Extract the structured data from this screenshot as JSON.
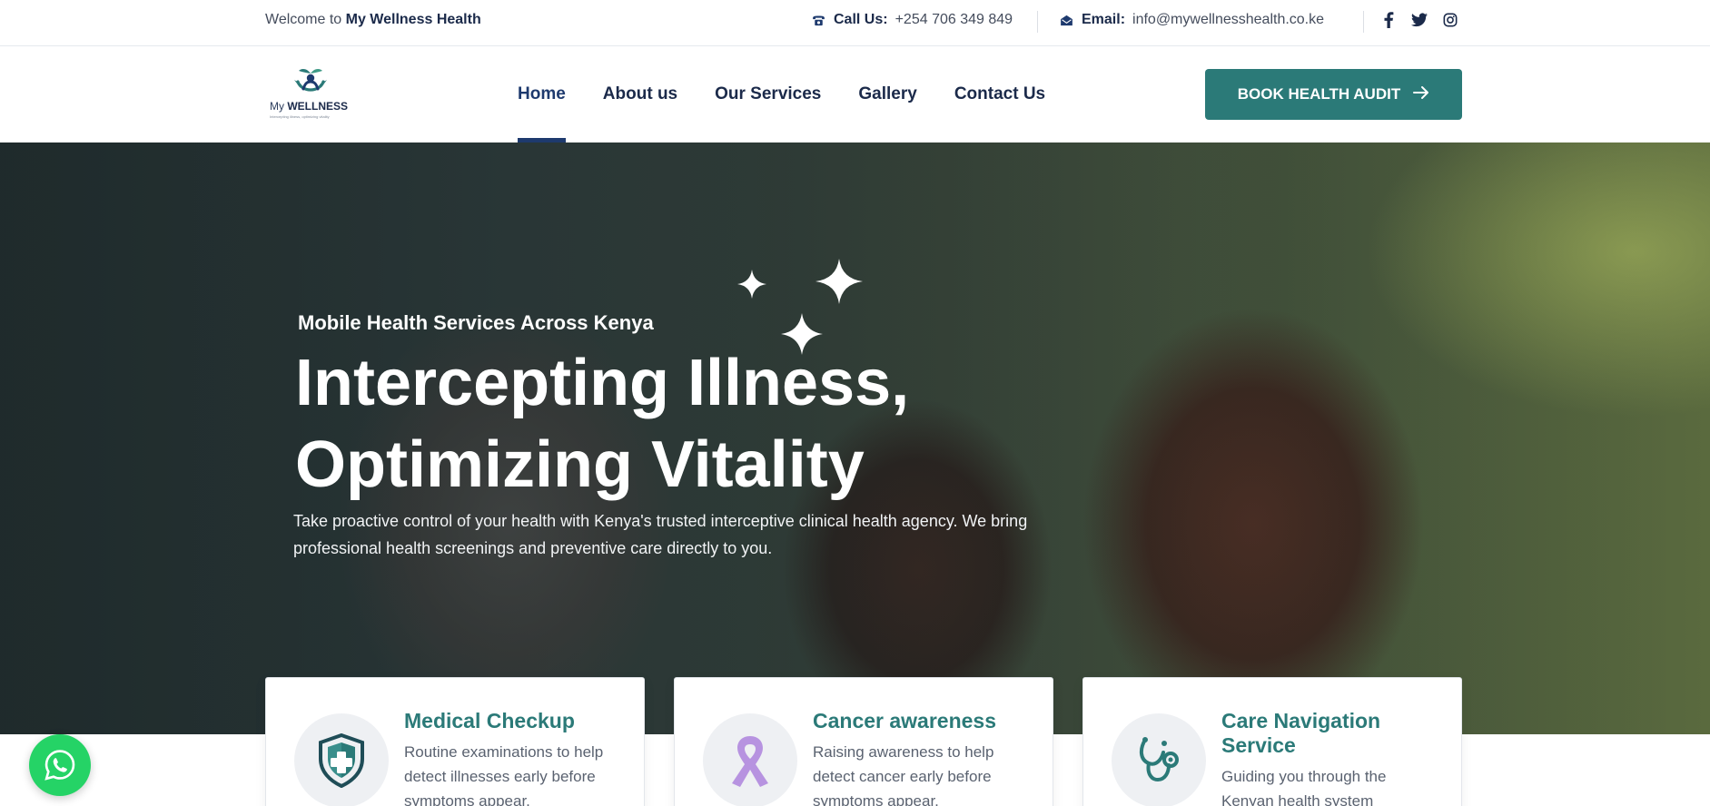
{
  "topbar": {
    "welcome_prefix": "Welcome to ",
    "welcome_brand": "My Wellness Health",
    "call_label": "Call Us:",
    "call_value": "+254 706 349 849",
    "email_label": "Email:",
    "email_value": "info@mywellnesshealth.co.ke",
    "social_icons": [
      "facebook-icon",
      "twitter-icon",
      "instagram-icon"
    ]
  },
  "logo": {
    "brand_prefix": "My ",
    "brand_main": "WELLNESS",
    "tagline": "Intercepting illness, optimizing vitality"
  },
  "nav": {
    "items": [
      "Home",
      "About us",
      "Our Services",
      "Gallery",
      "Contact Us"
    ],
    "active": "Home"
  },
  "cta": {
    "label": "BOOK HEALTH AUDIT"
  },
  "hero": {
    "kicker": "Mobile Health Services Across Kenya",
    "title_line1": "Intercepting Illness,",
    "title_line2": "Optimizing Vitality",
    "lede": "Take proactive control of your health with Kenya's trusted interceptive clinical health agency. We bring professional health screenings and preventive care directly to you."
  },
  "services": [
    {
      "title": "Medical Checkup",
      "text": "Routine examinations to help detect illnesses early before symptoms appear.",
      "icon": "shield-cross-icon"
    },
    {
      "title": "Cancer awareness",
      "text": "Raising awareness to help detect cancer early before symptoms appear.",
      "icon": "ribbon-icon"
    },
    {
      "title": "Care Navigation Service",
      "text": "Guiding you through the Kenyan health system",
      "icon": "stethoscope-icon"
    }
  ],
  "colors": {
    "brand_teal": "#2b7a78",
    "navy": "#1b2a4a",
    "whatsapp": "#25d366",
    "ribbon": "#b793e0"
  }
}
